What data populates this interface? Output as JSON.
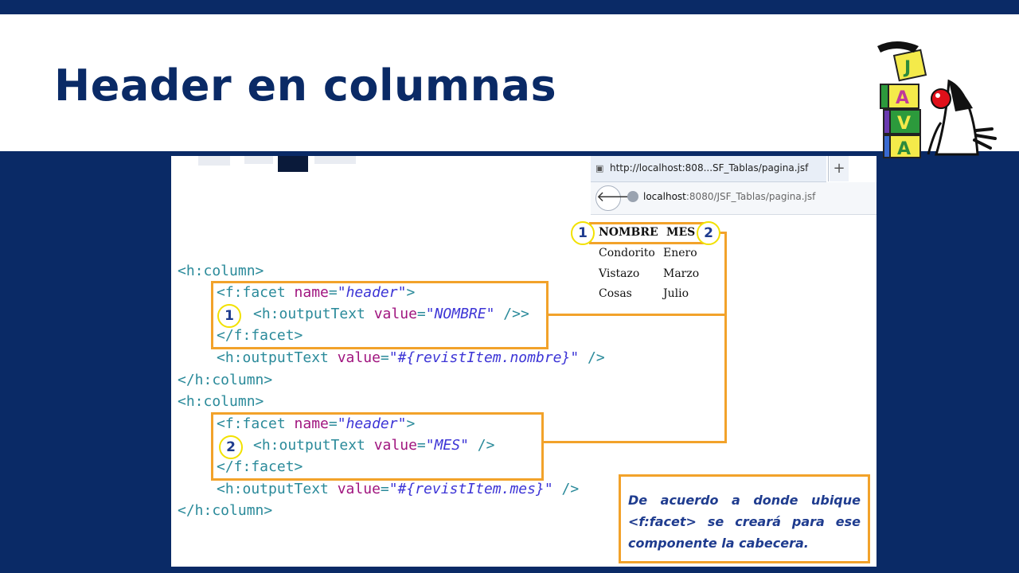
{
  "slide": {
    "title": "Header en columnas"
  },
  "browser": {
    "tab_title": "http://localhost:808...SF_Tablas/pagina.jsf",
    "new_tab_glyph": "+",
    "back_glyph": "🡐",
    "url_host": "localhost",
    "url_rest": ":8080/JSF_Tablas/pagina.jsf"
  },
  "rendered_table": {
    "headers": [
      "NOMBRE",
      "MES"
    ],
    "rows": [
      [
        "Condorito",
        "Enero"
      ],
      [
        "Vistazo",
        "Marzo"
      ],
      [
        "Cosas",
        "Julio"
      ]
    ]
  },
  "markers": [
    "1",
    "2"
  ],
  "code": {
    "col_open": "<h:column>",
    "col_close": "</h:column>",
    "facet_open_tag": "<f:facet ",
    "facet_attr": "name",
    "facet_val": "\"header\"",
    "facet_close_gt": ">",
    "facet_end": "</f:facet>",
    "output_tag": "<h:outputText ",
    "value_attr": "value",
    "eq": "=",
    "header1_val": "\"NOMBRE\"",
    "header2_val": "\"MES\"",
    "self_close": " />",
    "item1_val": "\"#{revistItem.nombre}\"",
    "item2_val": "\"#{revistItem.mes}\""
  },
  "note": {
    "text": "De acuerdo a donde ubique <f:facet> se creará para ese componente la cabecera."
  },
  "colors": {
    "slide_bg": "#0a2a66",
    "accent": "#f2a22a",
    "marker_border": "#f2e100",
    "note_text": "#1f3c8f"
  }
}
